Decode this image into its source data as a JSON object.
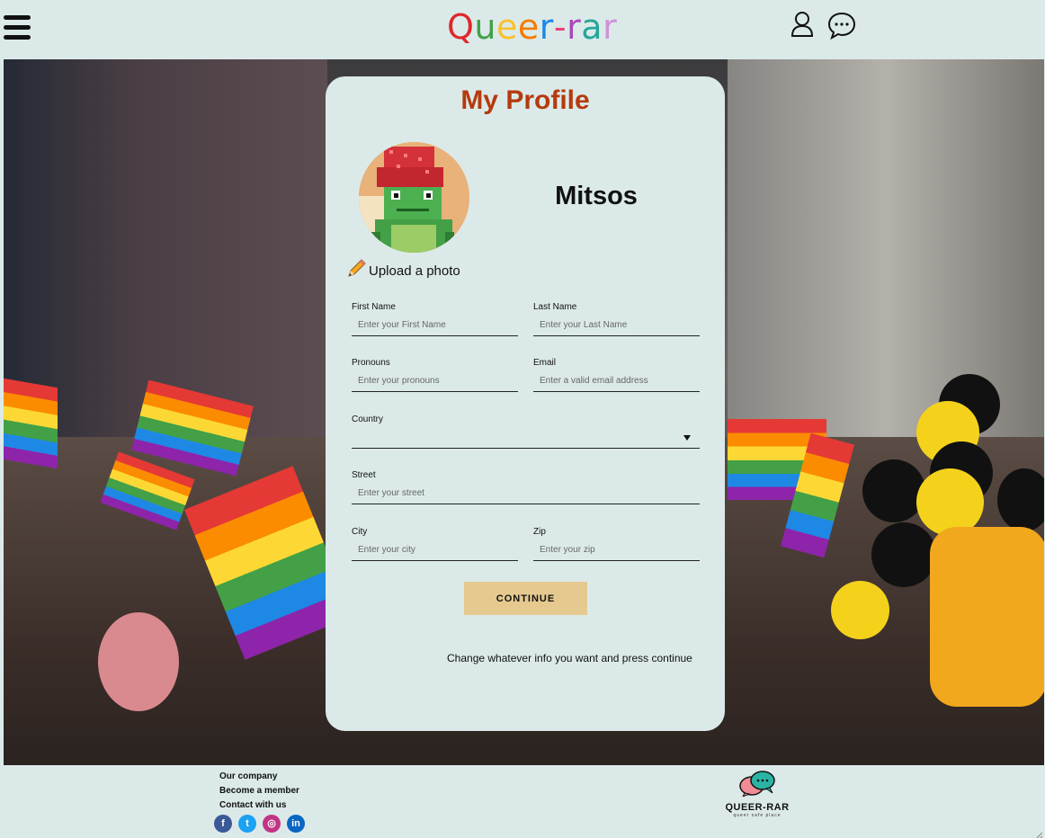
{
  "header": {
    "logo_letters": [
      {
        "ch": "Q",
        "color": "#e0282b"
      },
      {
        "ch": "u",
        "color": "#43a047"
      },
      {
        "ch": "e",
        "color": "#fbc02d"
      },
      {
        "ch": "e",
        "color": "#f57c00"
      },
      {
        "ch": "r",
        "color": "#1e88e5"
      },
      {
        "ch": "-",
        "color": "#ec407a"
      },
      {
        "ch": "r",
        "color": "#ab47bc"
      },
      {
        "ch": "a",
        "color": "#26a69a"
      },
      {
        "ch": "r",
        "color": "#ce93d8"
      }
    ],
    "icons": [
      "menu-icon",
      "user-icon",
      "chat-icon"
    ]
  },
  "profile": {
    "title": "My Profile",
    "username": "Mitsos",
    "upload_label": "Upload a photo",
    "fields": {
      "first_name": {
        "label": "First Name",
        "placeholder": "Enter your First Name"
      },
      "last_name": {
        "label": "Last Name",
        "placeholder": "Enter your Last Name"
      },
      "pronouns": {
        "label": "Pronouns",
        "placeholder": "Enter your pronouns"
      },
      "email": {
        "label": "Email",
        "placeholder": "Enter a valid email address"
      },
      "country": {
        "label": "Country",
        "value": ""
      },
      "street": {
        "label": "Street",
        "placeholder": "Enter your street"
      },
      "city": {
        "label": "City",
        "placeholder": "Enter your city"
      },
      "zip": {
        "label": "Zip",
        "placeholder": "Enter your zip"
      }
    },
    "continue_label": "CONTINUE",
    "hint": "Change whatever info you want and press continue"
  },
  "footer": {
    "links": [
      "Our company",
      "Become a member",
      "Contact with us"
    ],
    "social": [
      {
        "name": "facebook-icon",
        "glyph": "f",
        "color": "#3b5998"
      },
      {
        "name": "twitter-icon",
        "glyph": "t",
        "color": "#1da1f2"
      },
      {
        "name": "instagram-icon",
        "glyph": "◎",
        "color": "#c13584"
      },
      {
        "name": "linkedin-icon",
        "glyph": "in",
        "color": "#0a66c2"
      }
    ],
    "brand_name": "QUEER-RAR",
    "brand_tagline": "queer safe place"
  },
  "colors": {
    "background": "#dbeae9",
    "title": "#b53a0e",
    "button": "#e5c98f"
  }
}
